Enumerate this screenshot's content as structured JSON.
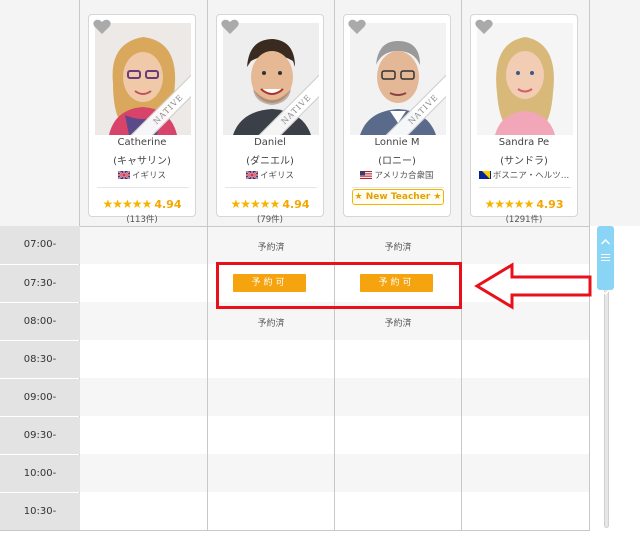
{
  "teachers": [
    {
      "name": "Catherine",
      "kana": "(キャサリン)",
      "country": "イギリス",
      "flag": "uk",
      "native": "NATIVE",
      "stars": "★★★★★",
      "score": "4.94",
      "reviews": "(113件)",
      "new_teacher": null
    },
    {
      "name": "Daniel",
      "kana": "(ダニエル)",
      "country": "イギリス",
      "flag": "uk",
      "native": "NATIVE",
      "stars": "★★★★★",
      "score": "4.94",
      "reviews": "(79件)",
      "new_teacher": null
    },
    {
      "name": "Lonnie M",
      "kana": "(ロニー)",
      "country": "アメリカ合衆国",
      "flag": "us",
      "native": "NATIVE",
      "stars": null,
      "score": null,
      "reviews": null,
      "new_teacher": "★ New Teacher ★"
    },
    {
      "name": "Sandra Pe",
      "kana": "(サンドラ)",
      "country": "ボスニア・ヘルツ…",
      "flag": "ba",
      "native": null,
      "stars": "★★★★★",
      "score": "4.93",
      "reviews": "(1291件)",
      "new_teacher": null
    }
  ],
  "times": [
    "07:00-",
    "07:30-",
    "08:00-",
    "08:30-",
    "09:00-",
    "09:30-",
    "10:00-",
    "10:30-"
  ],
  "slots": {
    "booked_label": "予約済",
    "available_label": "予約可"
  },
  "colors": {
    "accent": "#f5a40f",
    "star": "#f6b400",
    "annotation": "#e8101b",
    "scrollbar": "#8ad5f5"
  },
  "icons": {
    "favorite": "heart-icon",
    "scroll_up": "chevron-up-icon",
    "scroll_down": "chevron-down-icon"
  }
}
